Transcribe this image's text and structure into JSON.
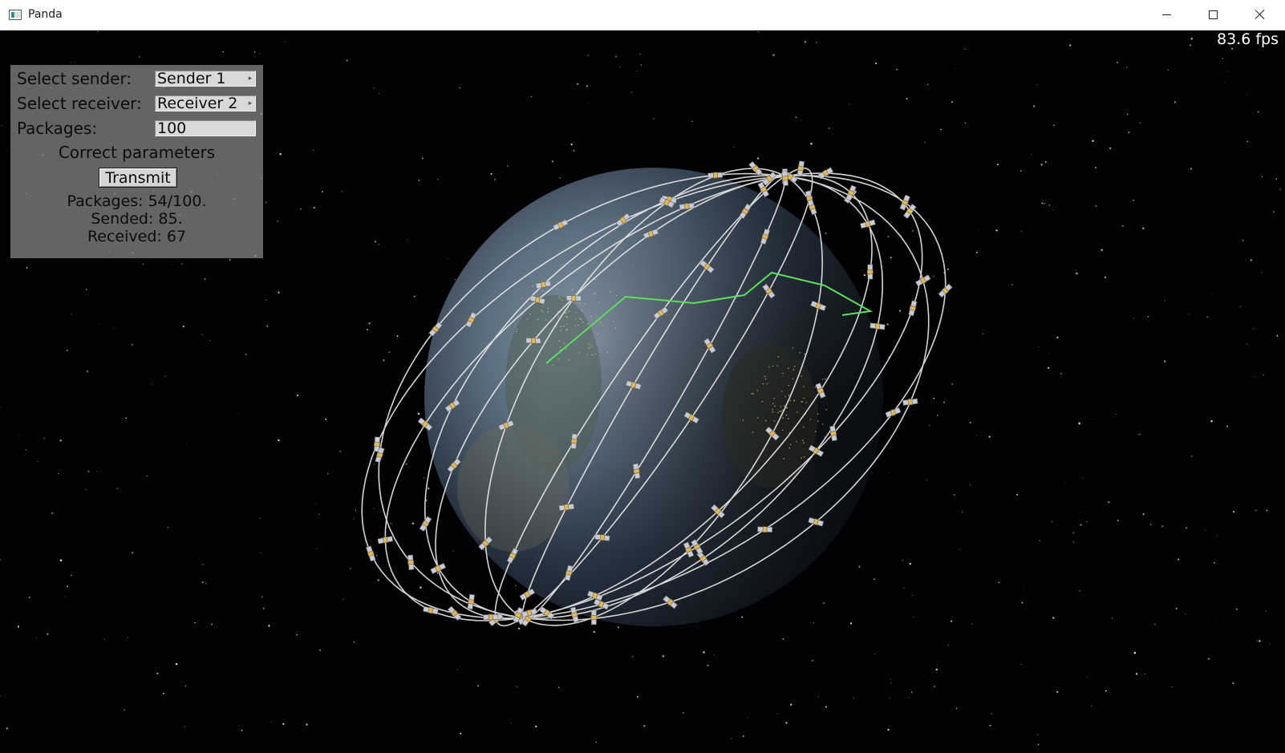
{
  "window": {
    "title": "Panda",
    "app_icon": "panda-app-icon",
    "controls": [
      "minimize-icon",
      "maximize-icon",
      "close-icon"
    ]
  },
  "overlay": {
    "fps": "83.6 fps"
  },
  "panel": {
    "sender_label": "Select sender:",
    "sender_value": "Sender 1",
    "receiver_label": "Select receiver:",
    "receiver_value": "Receiver 2",
    "packages_label": "Packages:",
    "packages_value": "100",
    "status": "Correct parameters",
    "transmit_label": "Transmit",
    "stats": {
      "packages": "Packages: 54/100.",
      "sended": "Sended: 85.",
      "received": "Received: 67"
    }
  },
  "colors": {
    "route": "#5fdc5f",
    "orbit": "#e8e8e8",
    "panel_bg": "#808080",
    "space": "#020204"
  }
}
